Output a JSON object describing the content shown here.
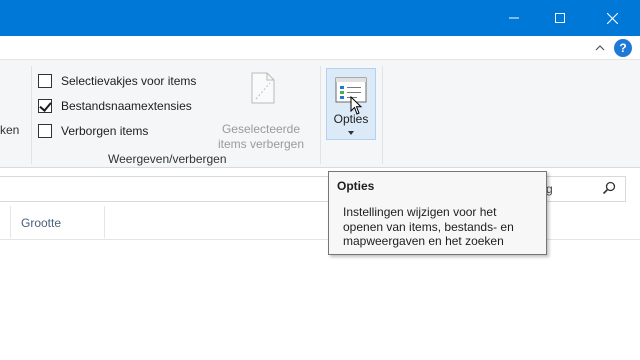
{
  "window": {
    "controls": {
      "minimize_icon": "minimize-icon",
      "maximize_icon": "maximize-icon",
      "close_icon": "close-icon"
    },
    "accent_color": "#0078d7"
  },
  "ribbon": {
    "collapse_icon": "chevron-up-icon",
    "help_label": "?",
    "left_group_partial_label": "ken",
    "show_hide_group": {
      "label": "Weergeven/verbergen",
      "checkboxes": [
        {
          "label": "Selectievakjes voor items",
          "checked": false
        },
        {
          "label": "Bestandsnaamextensies",
          "checked": true
        },
        {
          "label": "Verborgen items",
          "checked": false
        }
      ],
      "hide_selected": {
        "label_line1": "Geselecteerde",
        "label_line2": "items verbergen",
        "enabled": false
      }
    },
    "options_button": {
      "label": "Opties",
      "dropdown_icon": "dropdown-arrow-icon"
    }
  },
  "address_bar": {
    "search_partial_text": "g",
    "search_icon": "search-icon"
  },
  "columns": [
    {
      "label": "Grootte"
    }
  ],
  "tooltip": {
    "title": "Opties",
    "lines": [
      "Instellingen wijzigen voor het",
      "openen van items, bestands- en",
      "mapweergaven en het zoeken"
    ]
  }
}
